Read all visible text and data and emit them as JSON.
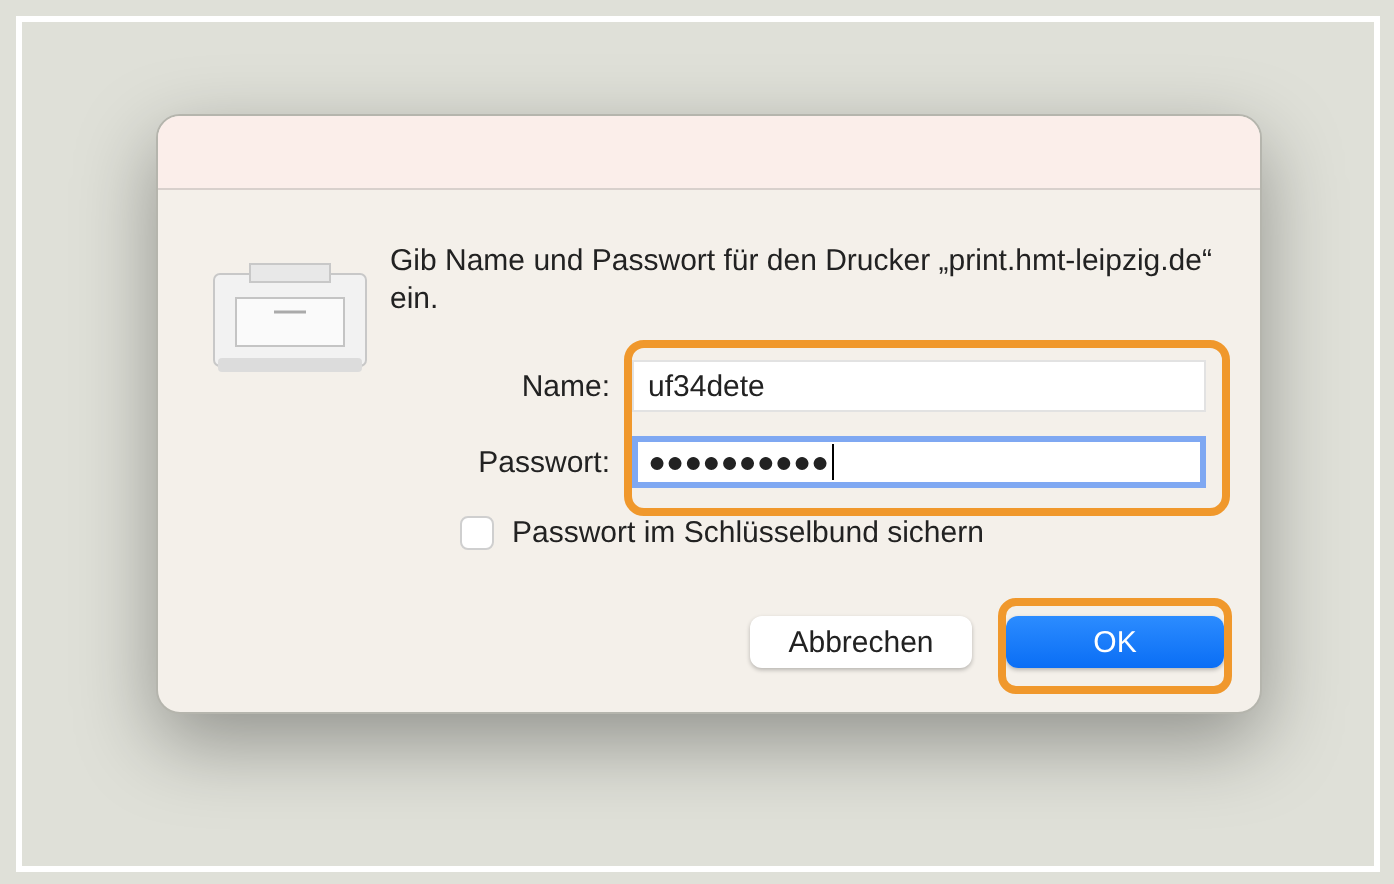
{
  "dialog": {
    "message": "Gib Name und Passwort für den Drucker „print.hmt-leipzig.de“ ein.",
    "fields": [
      {
        "label": "Name:",
        "value": "uf34dete",
        "focused": false
      },
      {
        "label": "Passwort:",
        "value": "●●●●●●●●●●",
        "focused": true
      }
    ],
    "fields_highlighted": true,
    "remember": {
      "label": "Passwort im Schlüsselbund sichern",
      "checked": false
    },
    "buttons": [
      {
        "label": "Abbrechen",
        "kind": "secondary",
        "highlighted": false
      },
      {
        "label": "OK",
        "kind": "primary",
        "highlighted": true
      }
    ]
  }
}
